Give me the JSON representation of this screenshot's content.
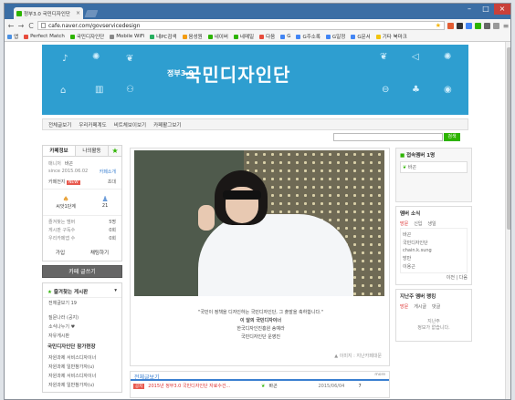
{
  "browser": {
    "tab_title": "정부3.0 국민디자인단",
    "tab_close": "×",
    "url": "cafe.naver.com/govservicedesign",
    "back": "←",
    "forward": "→",
    "reload": "C"
  },
  "bookmarks": [
    {
      "label": "앱",
      "color": "#4a90e2"
    },
    {
      "label": "Perfect Match",
      "color": "#e74c3c"
    },
    {
      "label": "국민디자인단",
      "color": "#2db400"
    },
    {
      "label": "Mobile WiFi",
      "color": "#888"
    },
    {
      "label": "내PC검색",
      "color": "#27ae60"
    },
    {
      "label": "음성원",
      "color": "#f39c12"
    },
    {
      "label": "네이버",
      "color": "#2db400"
    },
    {
      "label": "네메일",
      "color": "#2db400"
    },
    {
      "label": "다음",
      "color": "#e74c3c"
    },
    {
      "label": "G",
      "color": "#4285f4"
    },
    {
      "label": "G주소록",
      "color": "#4285f4"
    },
    {
      "label": "G일정",
      "color": "#4285f4"
    },
    {
      "label": "G문서",
      "color": "#4285f4"
    },
    {
      "label": "기타 북마크",
      "color": "#f1c40f"
    }
  ],
  "banner": {
    "title_small": "정부3.0",
    "title": "국민디자인단"
  },
  "menu": [
    "전체글보기",
    "우리카페계도",
    "비트체보이보기",
    "카페활그보기"
  ],
  "search": {
    "button": "검색"
  },
  "left": {
    "tabs": [
      "카페정보",
      "나의활동"
    ],
    "manager_label": "매니저",
    "manager": "바곤",
    "since": "since 2015.06.02",
    "intro": "카페소개",
    "cafe_level": "카페전지",
    "new": "NEW",
    "invite": "초대",
    "level_name": "씨앗1단계",
    "members": "21",
    "stats": [
      {
        "label": "즐겨찾는 멤버",
        "value": "5명"
      },
      {
        "label": "게시판 구독수",
        "value": "0회"
      },
      {
        "label": "우리카페앱 수",
        "value": "0회"
      }
    ],
    "join": "가입",
    "invite_btn": "채팅하기",
    "write": "카페 글쓰기",
    "fav_title": "즐겨찾는 게시판",
    "fav_more": "▾",
    "fav_items": [
      "전체글보기 19",
      "",
      "질문나라 (공지)",
      "소식나누기 ♥",
      "자유게시판"
    ],
    "section_title": "국민디자인단 참가현장",
    "section_items": [
      "자원과제 서비스디자이너",
      "자원과제 일반참가자(u)",
      "자원과제 서비스디자이너",
      "자원과제 일반참가자(u)"
    ]
  },
  "content": {
    "quote1": "\"국민이 정책을 디자인하는 국민디자인단, 그 출발을 축하합니다.\"",
    "quote2": "이 달의 국민디자이너",
    "quote3": "한국디자인진흥원 송예라",
    "quote4": "국민디자인단 운영진",
    "credit": "▲ 이미지 : 지난카페대문"
  },
  "board": {
    "title": "전체글보기",
    "more": "more",
    "rows": [
      {
        "badge": "공지",
        "title": "2015년 정부3.0 국민디자인단 자료수건...",
        "author": "바곤",
        "date": "2015/06/04",
        "views": "7"
      }
    ]
  },
  "right": {
    "connected_title": "접속멤버 1명",
    "connected_member": "바곤",
    "news_title": "멤버 소식",
    "news_tabs": [
      "방문",
      "신입",
      "생일"
    ],
    "news_items": [
      "바곤",
      "국민디자인단",
      "chain.k.sung",
      "방만",
      "이용근"
    ],
    "news_pager": "이전 | 다음",
    "recent_title": "지난주 멤버 랭킹",
    "recent_tabs": [
      "방문",
      "게시글",
      "댓글"
    ],
    "recent_empty": "지난주\n정보가 없습니다."
  }
}
